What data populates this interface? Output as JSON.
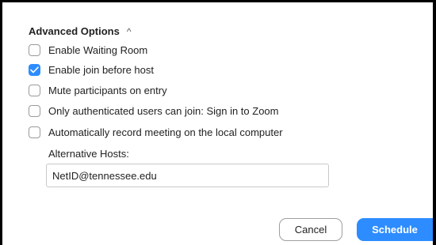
{
  "section": {
    "title": "Advanced Options",
    "caret_icon": "chevron-up-icon",
    "expanded": true
  },
  "options": [
    {
      "label": "Enable Waiting Room",
      "checked": false
    },
    {
      "label": "Enable join before host",
      "checked": true
    },
    {
      "label": "Mute participants on entry",
      "checked": false
    },
    {
      "label": "Only authenticated users can join: Sign in to Zoom",
      "checked": false
    },
    {
      "label": "Automatically record meeting on the local computer",
      "checked": false
    }
  ],
  "alternative_hosts": {
    "label": "Alternative Hosts:",
    "value": "NetID@tennessee.edu"
  },
  "buttons": {
    "cancel_label": "Cancel",
    "schedule_label": "Schedule"
  },
  "colors": {
    "accent": "#2d8cff",
    "frame": "#000000"
  }
}
